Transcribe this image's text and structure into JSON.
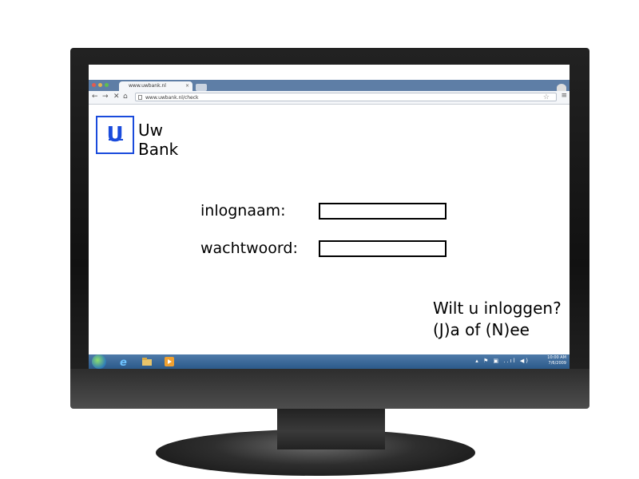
{
  "browser": {
    "tab_title": "www.uwbank.nl",
    "tab_close": "×",
    "url": "www.uwbank.nl/check",
    "nav_back": "←",
    "nav_forward": "→",
    "nav_stop": "✕",
    "nav_home": "⌂",
    "star": "☆",
    "menu": "≡"
  },
  "logo": {
    "letter": "U",
    "line1": "Uw",
    "line2": "Bank",
    "color": "#1a4bdc"
  },
  "form": {
    "username_label": "inlognaam:",
    "password_label": "wachtwoord:"
  },
  "prompt": {
    "line1": "Wilt u inloggen?",
    "line2": "(J)a of (N)ee"
  },
  "taskbar": {
    "clock_time": "10:00 AM",
    "clock_date": "7/6/2009",
    "tray": "▴ ⚑ ▣ ..ıl ◀)"
  },
  "colors": {
    "taskbar": "#2c5a8a",
    "tabbar": "#5e7ea6",
    "accent_red": "#e00000"
  }
}
